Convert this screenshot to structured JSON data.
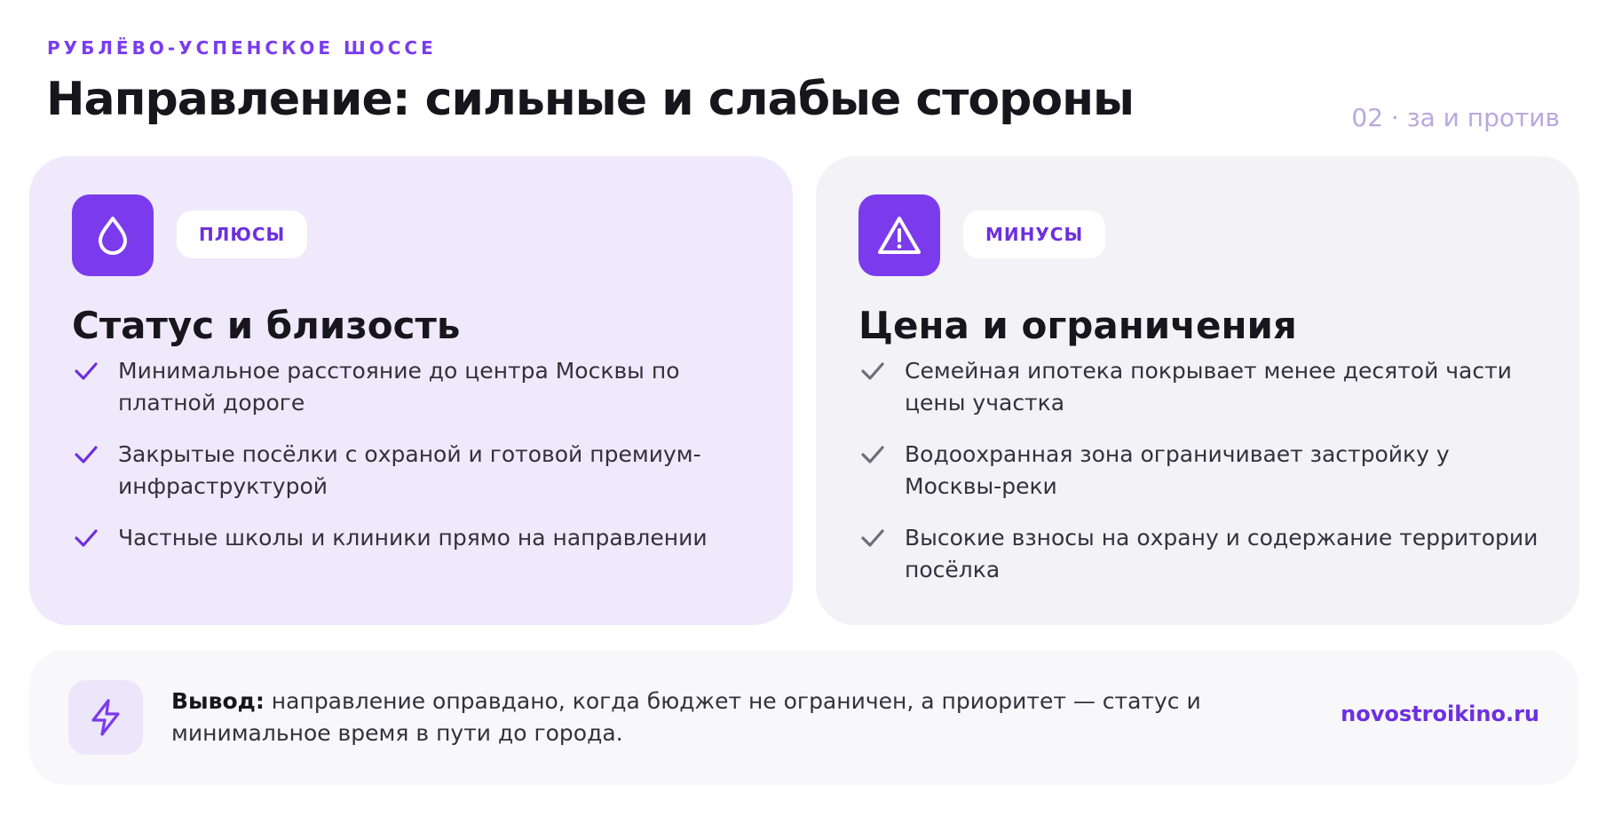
{
  "header": {
    "kicker": "РУБЛЁВО-УСПЕНСКОЕ ШОССЕ",
    "title": "Направление: сильные и слабые стороны",
    "page_tag": "02 · за и против"
  },
  "pros": {
    "badge": "ПЛЮСЫ",
    "icon": "drop-icon",
    "title": "Статус и близость",
    "items": [
      "Минимальное расстояние до центра Москвы по платной дороге",
      "Закрытые посёлки с охраной и готовой премиум-инфраструктурой",
      "Частные школы и клиники прямо на направлении"
    ]
  },
  "cons": {
    "badge": "МИНУСЫ",
    "icon": "warning-icon",
    "title": "Цена и ограничения",
    "items": [
      "Семейная ипотека покрывает менее десятой части цены участка",
      "Водоохранная зона ограничивает застройку у Москвы-реки",
      "Высокие взносы на охрану и содержание территории посёлка"
    ]
  },
  "summary": {
    "icon": "lightning-icon",
    "lead": "Вывод:",
    "text": " направление оправдано, когда бюджет не ограничен, а приоритет — статус и минимальное время в пути до города.",
    "site": "novostroikino.ru"
  },
  "colors": {
    "accent": "#7b3bec",
    "pros_bg": "#efe9fb",
    "cons_bg": "#f3f2f6",
    "pros_check": "#6d2fe0",
    "cons_check": "#6f6e77"
  }
}
